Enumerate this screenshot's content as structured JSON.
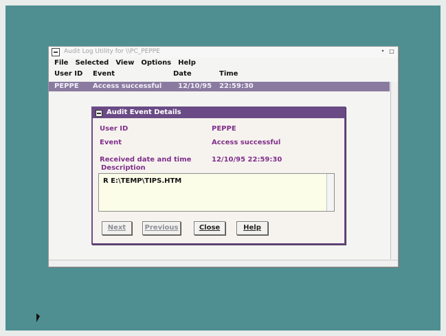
{
  "main_window": {
    "title": "Audit Log Utility for \\\\PC_PEPPE",
    "controls": {
      "minimize": "•",
      "restore": "□"
    }
  },
  "menu": {
    "items": [
      "File",
      "Selected",
      "View",
      "Options",
      "Help"
    ]
  },
  "table": {
    "headers": [
      "User ID",
      "Event",
      "Date",
      "Time"
    ],
    "rows": [
      [
        "PEPPE",
        "Access successful",
        "12/10/95",
        "22:59:30"
      ]
    ]
  },
  "dialog": {
    "title": "Audit Event Details",
    "fields": [
      {
        "label": "User ID",
        "value": "PEPPE"
      },
      {
        "label": "Event",
        "value": "Access successful"
      },
      {
        "label": "Received date and time",
        "value": "12/10/95 22:59:30"
      }
    ],
    "description_label": "Description",
    "description_text": "R E:\\TEMP\\TIPS.HTM",
    "buttons": [
      "Next",
      "Previous",
      "Close",
      "Help"
    ]
  },
  "colors": {
    "desktop": "#4f8f92",
    "selection": "#8a7aa0",
    "dialog_title": "#6a4b86",
    "label_text": "#7f2f8a"
  },
  "icons": [
    "system-menu-icon",
    "mouse-pointer-icon"
  ]
}
